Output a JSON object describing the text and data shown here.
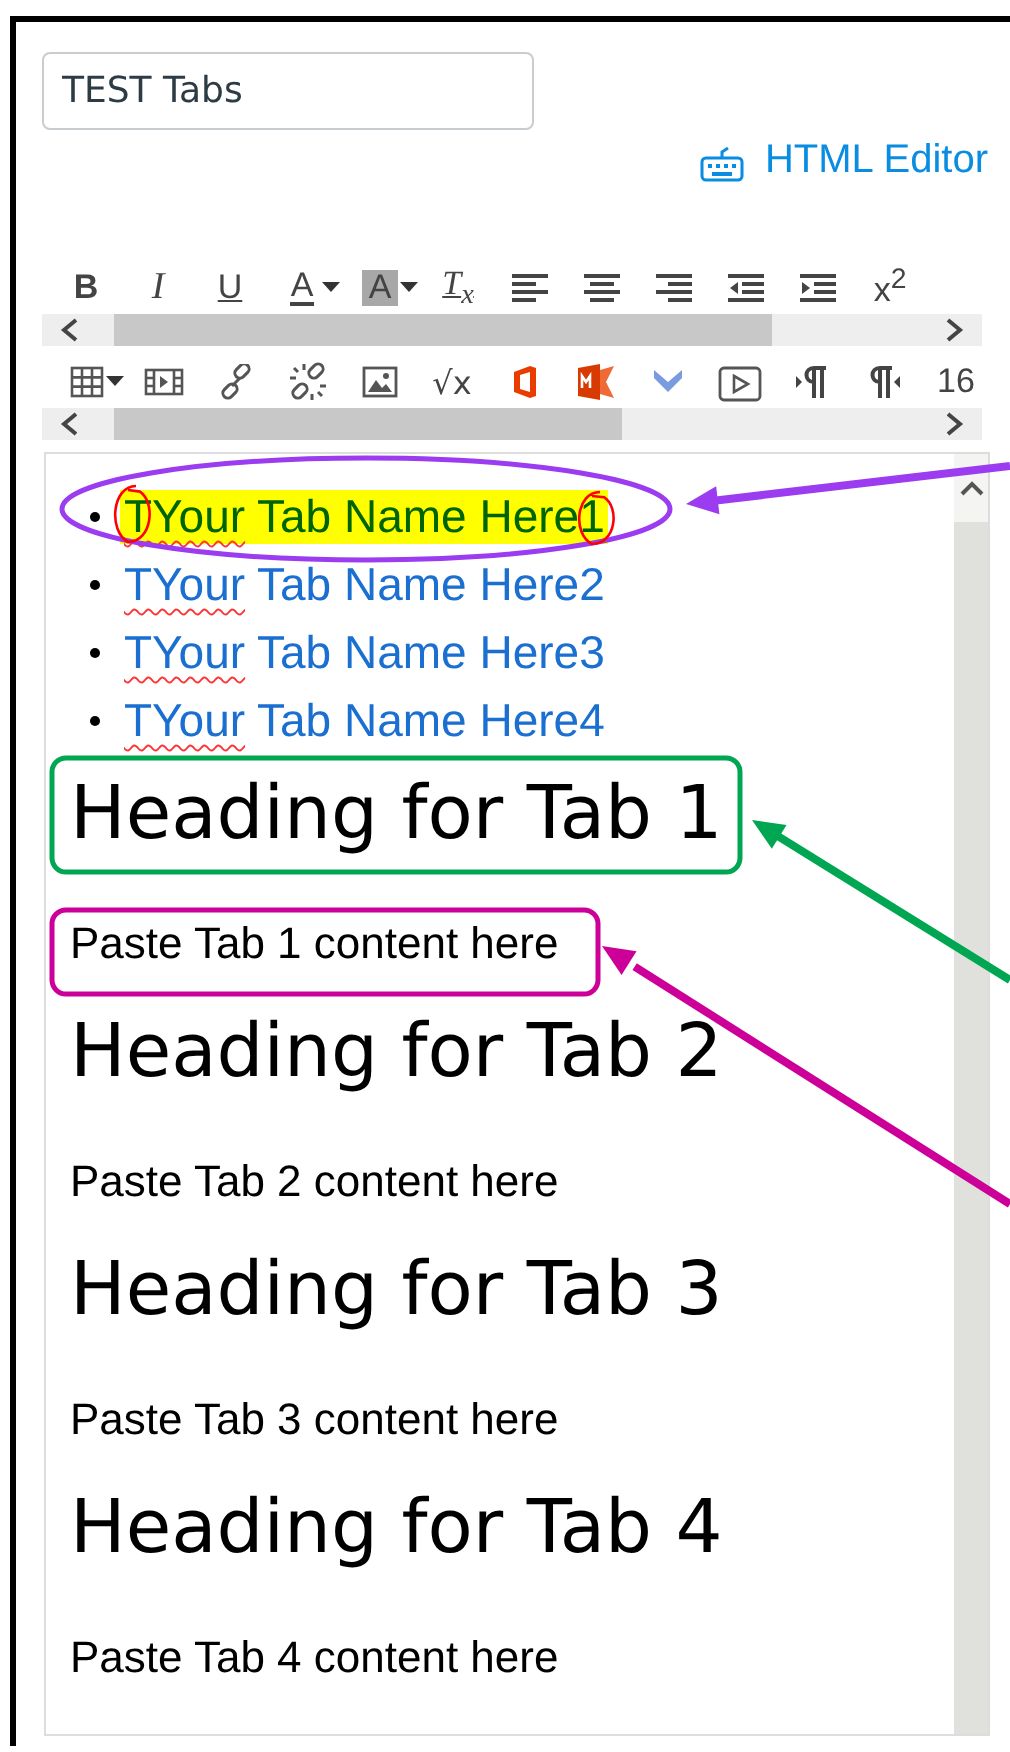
{
  "title_field": {
    "value": "TEST Tabs"
  },
  "html_editor_link": {
    "label": "HTML Editor"
  },
  "toolbar_rows": [
    {
      "items": [
        {
          "kind": "bold",
          "text": "B"
        },
        {
          "kind": "italic",
          "text": "I"
        },
        {
          "kind": "underline",
          "text": "U"
        },
        {
          "kind": "text-color",
          "text": "A"
        },
        {
          "kind": "caret"
        },
        {
          "kind": "highlight",
          "text": "A"
        },
        {
          "kind": "caret"
        },
        {
          "kind": "clear-format",
          "text": "T$_{x}$"
        },
        {
          "kind": "align-left"
        },
        {
          "kind": "align-center"
        },
        {
          "kind": "align-right"
        },
        {
          "kind": "outdent"
        },
        {
          "kind": "indent"
        },
        {
          "kind": "superscript",
          "text": "x$^{2}$"
        }
      ]
    },
    {
      "items": [
        {
          "kind": "table"
        },
        {
          "kind": "caret"
        },
        {
          "kind": "media"
        },
        {
          "kind": "link"
        },
        {
          "kind": "unlink"
        },
        {
          "kind": "image"
        },
        {
          "kind": "math",
          "text": "√x"
        },
        {
          "kind": "office"
        },
        {
          "kind": "office-m"
        },
        {
          "kind": "chevron"
        },
        {
          "kind": "video"
        },
        {
          "kind": "pilcrow-ltr"
        },
        {
          "kind": "pilcrow-rtl"
        },
        {
          "kind": "font-size",
          "text": "16"
        }
      ]
    }
  ],
  "content": [
    {
      "kind": "list",
      "items": [
        {
          "text": "TYour Tab Name Here1",
          "highlighted": true
        },
        {
          "text": "TYour Tab Name Here2",
          "highlighted": false
        },
        {
          "text": "TYour Tab Name Here3",
          "highlighted": false
        },
        {
          "text": "TYour Tab Name Here4",
          "highlighted": false
        }
      ]
    },
    {
      "kind": "heading",
      "text": "Heading for Tab 1"
    },
    {
      "kind": "paragraph",
      "text": "Paste Tab 1 content here"
    },
    {
      "kind": "heading",
      "text": "Heading for Tab 2"
    },
    {
      "kind": "paragraph",
      "text": "Paste Tab 2 content here"
    },
    {
      "kind": "heading",
      "text": "Heading for Tab 3"
    },
    {
      "kind": "paragraph",
      "text": "Paste Tab 3 content here"
    },
    {
      "kind": "heading",
      "text": "Heading for Tab 4"
    },
    {
      "kind": "paragraph",
      "text": "Paste Tab 4 content here"
    }
  ],
  "annotations": [
    {
      "kind": "ellipse",
      "color": "#9b3cf0"
    },
    {
      "kind": "scribble",
      "color": "#ff0000"
    },
    {
      "kind": "scribble",
      "color": "#ff0000"
    },
    {
      "kind": "box",
      "color": "#00a651"
    },
    {
      "kind": "box",
      "color": "#cc0099"
    }
  ]
}
